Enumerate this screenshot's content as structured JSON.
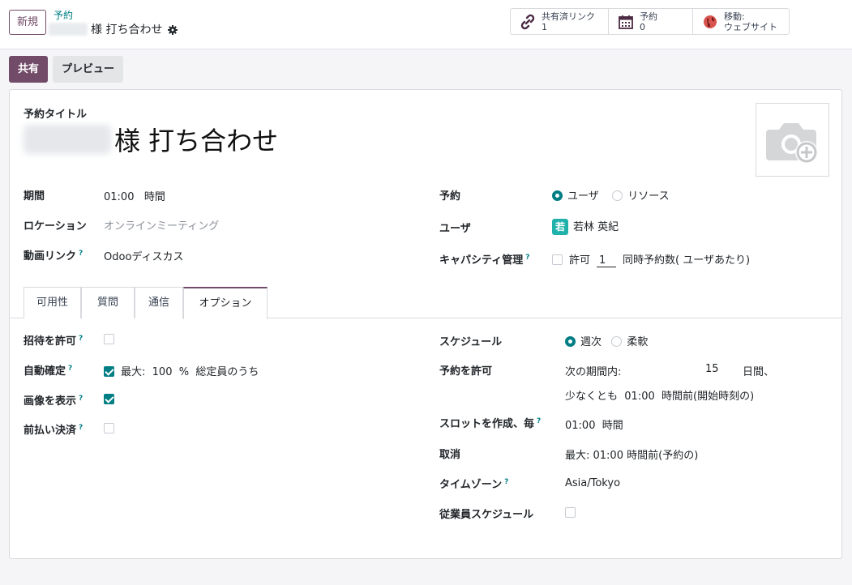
{
  "header": {
    "new_button": "新規",
    "breadcrumb_parent": "予約",
    "breadcrumb_current": "様 打ち合わせ",
    "stats": [
      {
        "label": "共有済リンク",
        "value": "1",
        "icon": "link-icon"
      },
      {
        "label": "予約",
        "value": "0",
        "icon": "calendar-icon"
      },
      {
        "label": "移動:",
        "value": "ウェブサイト",
        "icon": "globe-icon"
      }
    ]
  },
  "actions": {
    "share": "共有",
    "preview": "プレビュー"
  },
  "form": {
    "title_label": "予約タイトル",
    "title_value": "様 打ち合わせ",
    "left": {
      "duration_label": "期間",
      "duration_value": "01:00",
      "duration_unit": "時間",
      "location_label": "ロケーション",
      "location_placeholder": "オンラインミーティング",
      "video_label": "動画リンク",
      "video_value": "Odooディスカス"
    },
    "right": {
      "booking_label": "予約",
      "booking_options": [
        "ユーザ",
        "リソース"
      ],
      "users_label": "ユーザ",
      "user_initial": "若",
      "user_name": "若林 英紀",
      "capacity_label": "キャパシティ管理",
      "capacity_allow": "許可",
      "capacity_value": "1",
      "capacity_suffix": "同時予約数( ユーザあたり)"
    },
    "help_mark": "?"
  },
  "tabs": [
    {
      "label": "可用性"
    },
    {
      "label": "質問"
    },
    {
      "label": "通信"
    },
    {
      "label": "オプション",
      "active": true
    }
  ],
  "options": {
    "allow_invite_label": "招待を許可",
    "auto_confirm_label": "自動確定",
    "auto_confirm_max": "最大:",
    "auto_confirm_value": "100",
    "auto_confirm_unit": "%",
    "auto_confirm_suffix": "総定員のうち",
    "show_image_label": "画像を表示",
    "prepay_label": "前払い決済",
    "schedule_label": "スケジュール",
    "schedule_options": [
      "週次",
      "柔軟"
    ],
    "allow_booking_label": "予約を許可",
    "within_label": "次の期間内:",
    "within_value": "15",
    "within_unit": "日間、",
    "at_least_label": "少なくとも",
    "at_least_value": "01:00",
    "at_least_suffix": "時間前(開始時刻の)",
    "slot_label": "スロットを作成、毎",
    "slot_value": "01:00",
    "slot_unit": "時間",
    "cancel_label": "取消",
    "cancel_value": "最大: 01:00",
    "cancel_suffix": "時間前(予約の)",
    "timezone_label": "タイムゾーン",
    "timezone_value": "Asia/Tokyo",
    "employee_schedule_label": "従業員スケジュール"
  },
  "colors": {
    "primary": "#714b67",
    "accent": "#017e84"
  }
}
